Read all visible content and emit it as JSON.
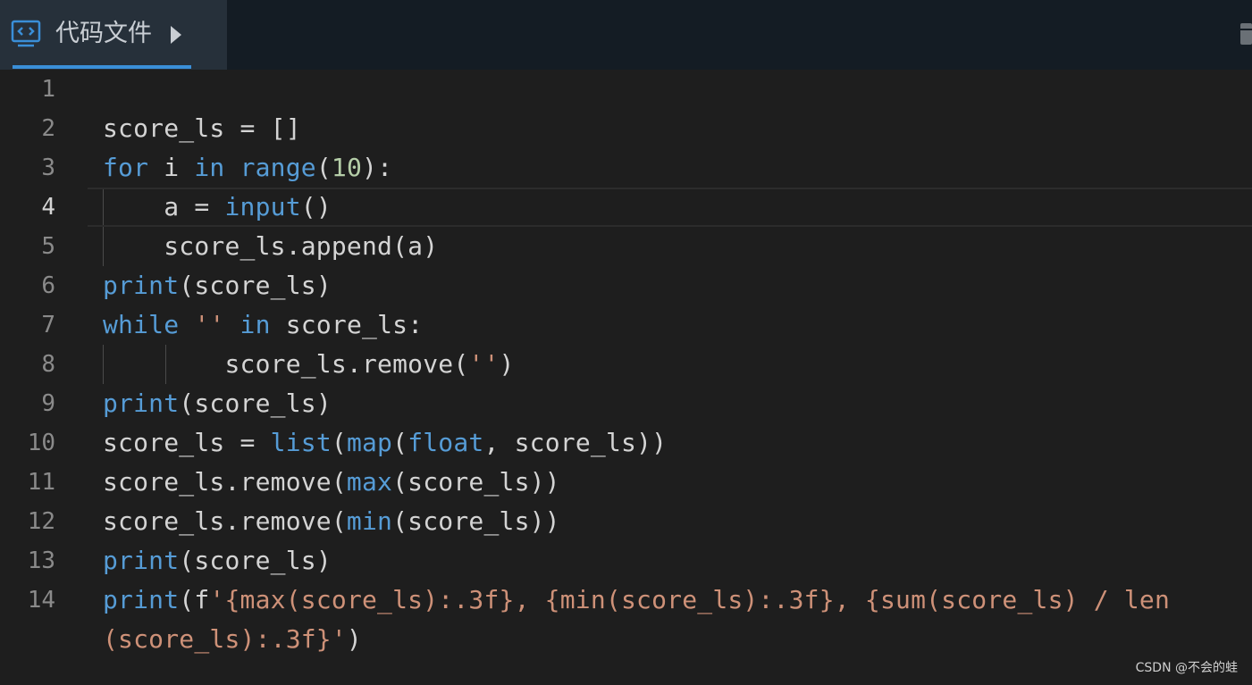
{
  "tab": {
    "label": "代码文件",
    "icon": "code-file-icon"
  },
  "code_lines": [
    {
      "n": "1",
      "tokens": []
    },
    {
      "n": "2",
      "tokens": [
        {
          "t": "score_ls = []",
          "c": "plain"
        }
      ]
    },
    {
      "n": "3",
      "tokens": [
        {
          "t": "for",
          "c": "kw"
        },
        {
          "t": " i ",
          "c": "plain"
        },
        {
          "t": "in",
          "c": "kw"
        },
        {
          "t": " ",
          "c": "plain"
        },
        {
          "t": "range",
          "c": "kw"
        },
        {
          "t": "(",
          "c": "plain"
        },
        {
          "t": "10",
          "c": "num"
        },
        {
          "t": "):",
          "c": "plain"
        }
      ]
    },
    {
      "n": "4",
      "current": true,
      "tokens": [
        {
          "t": "    a = ",
          "c": "plain"
        },
        {
          "t": "input",
          "c": "kw"
        },
        {
          "t": "()",
          "c": "plain"
        }
      ]
    },
    {
      "n": "5",
      "tokens": [
        {
          "t": "    score_ls.append(a)",
          "c": "plain"
        }
      ]
    },
    {
      "n": "6",
      "tokens": [
        {
          "t": "print",
          "c": "kw"
        },
        {
          "t": "(score_ls)",
          "c": "plain"
        }
      ]
    },
    {
      "n": "7",
      "tokens": [
        {
          "t": "while",
          "c": "kw"
        },
        {
          "t": " ",
          "c": "plain"
        },
        {
          "t": "''",
          "c": "str"
        },
        {
          "t": " ",
          "c": "plain"
        },
        {
          "t": "in",
          "c": "kw"
        },
        {
          "t": " score_ls:",
          "c": "plain"
        }
      ]
    },
    {
      "n": "8",
      "tokens": [
        {
          "t": "        score_ls.remove(",
          "c": "plain"
        },
        {
          "t": "''",
          "c": "str"
        },
        {
          "t": ")",
          "c": "plain"
        }
      ]
    },
    {
      "n": "9",
      "tokens": [
        {
          "t": "print",
          "c": "kw"
        },
        {
          "t": "(score_ls)",
          "c": "plain"
        }
      ]
    },
    {
      "n": "10",
      "tokens": [
        {
          "t": "score_ls = ",
          "c": "plain"
        },
        {
          "t": "list",
          "c": "kw"
        },
        {
          "t": "(",
          "c": "plain"
        },
        {
          "t": "map",
          "c": "kw"
        },
        {
          "t": "(",
          "c": "plain"
        },
        {
          "t": "float",
          "c": "kw"
        },
        {
          "t": ", score_ls))",
          "c": "plain"
        }
      ]
    },
    {
      "n": "11",
      "tokens": [
        {
          "t": "score_ls.remove(",
          "c": "plain"
        },
        {
          "t": "max",
          "c": "kw"
        },
        {
          "t": "(score_ls))",
          "c": "plain"
        }
      ]
    },
    {
      "n": "12",
      "tokens": [
        {
          "t": "score_ls.remove(",
          "c": "plain"
        },
        {
          "t": "min",
          "c": "kw"
        },
        {
          "t": "(score_ls))",
          "c": "plain"
        }
      ]
    },
    {
      "n": "13",
      "tokens": [
        {
          "t": "print",
          "c": "kw"
        },
        {
          "t": "(score_ls)",
          "c": "plain"
        }
      ]
    },
    {
      "n": "14",
      "tokens": [
        {
          "t": "print",
          "c": "kw"
        },
        {
          "t": "(f",
          "c": "plain"
        },
        {
          "t": "'{max(score_ls):.3f}, {min(score_ls):.3f}, {sum(score_ls) / len",
          "c": "str"
        }
      ]
    },
    {
      "n": "",
      "tokens": [
        {
          "t": "(score_ls):.3f}'",
          "c": "str"
        },
        {
          "t": ")",
          "c": "plain"
        }
      ]
    }
  ],
  "watermark": "CSDN @不会的蛙",
  "colors": {
    "keyword": "#569cd6",
    "number": "#b5cea8",
    "string": "#ce9178",
    "text": "#d4d4d4",
    "accent": "#3a8fd8"
  }
}
